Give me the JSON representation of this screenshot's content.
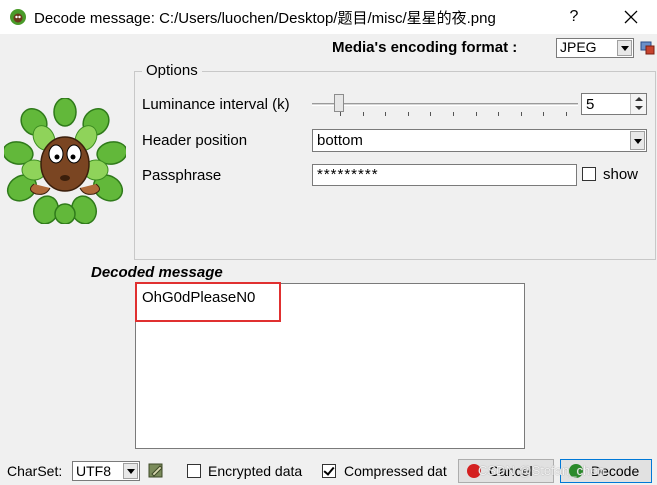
{
  "window": {
    "title": "Decode message: C:/Users/luochen/Desktop/题目/misc/星星的夜.png",
    "help_label": "?"
  },
  "format": {
    "label": "Media's encoding format :",
    "value": "JPEG"
  },
  "options": {
    "legend": "Options",
    "luminance": {
      "label": "Luminance interval (k)",
      "value": "5",
      "slider_fraction": 0.05
    },
    "header": {
      "label": "Header position",
      "value": "bottom"
    },
    "passphrase": {
      "label": "Passphrase",
      "value": "*********",
      "show_label": "show",
      "show_checked": false
    }
  },
  "decoded": {
    "label": "Decoded message",
    "text": "OhG0dPleaseN0"
  },
  "bottom": {
    "charset_label": "CharSet:",
    "charset_value": "UTF8",
    "encrypted_label": "Encrypted data",
    "encrypted_checked": false,
    "compressed_label": "Compressed dat",
    "compressed_checked": true,
    "cancel_label": "Cancel",
    "decode_label": "Decode"
  },
  "watermark": "CSDN @Stefan_chen",
  "colors": {
    "highlight": "#e03030",
    "cancel_icon": "#d42020",
    "decode_icon": "#2a8a2a"
  }
}
